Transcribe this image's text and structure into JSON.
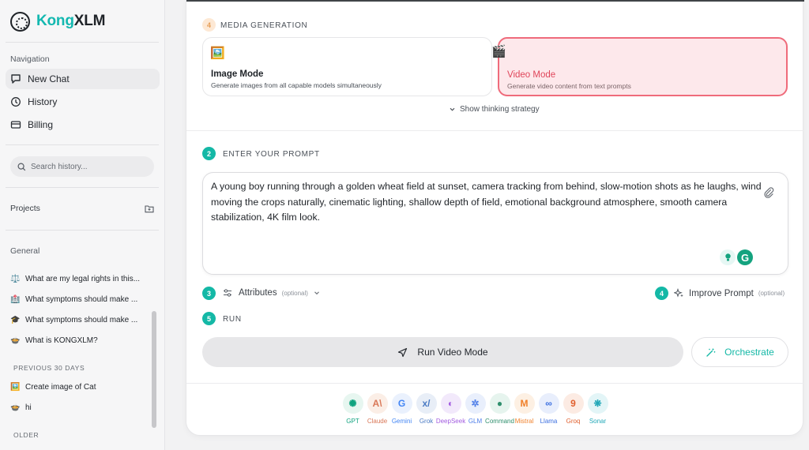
{
  "brand": {
    "name_part1": "Kong",
    "name_part2": "XLM"
  },
  "sidebar": {
    "nav_label": "Navigation",
    "nav_items": [
      {
        "label": "New Chat",
        "icon": "new-chat-icon",
        "active": true
      },
      {
        "label": "History",
        "icon": "history-icon"
      },
      {
        "label": "Billing",
        "icon": "billing-icon"
      }
    ],
    "search_placeholder": "Search history...",
    "projects_label": "Projects",
    "general_label": "General",
    "history": [
      {
        "emoji": "⚖️",
        "text": "What are my legal rights in this..."
      },
      {
        "emoji": "🏥",
        "text": "What symptoms should make ..."
      },
      {
        "emoji": "🎓",
        "text": "What symptoms should make ..."
      },
      {
        "emoji": "🍲",
        "text": "What is KONGXLM?"
      }
    ],
    "previous_30_label": "PREVIOUS 30 DAYS",
    "previous_30": [
      {
        "emoji": "🖼️",
        "text": "Create image of Cat"
      },
      {
        "emoji": "🍲",
        "text": "hi"
      }
    ],
    "older_label": "OLDER"
  },
  "media": {
    "step": "4",
    "label": "MEDIA GENERATION",
    "modes": [
      {
        "title": "Image Mode",
        "desc": "Generate images from all capable models simultaneously",
        "icon": "🖼️",
        "selected": false
      },
      {
        "title": "Video Mode",
        "desc": "Generate video content from text prompts",
        "icon": "🎬",
        "selected": true
      }
    ],
    "thinking_toggle": "Show thinking strategy"
  },
  "prompt": {
    "step": "2",
    "label": "ENTER YOUR PROMPT",
    "text": "A young boy running through a golden wheat field at sunset, camera tracking from behind, slow-motion shots as he laughs, wind moving the crops naturally, cinematic lighting, shallow depth of field, emotional background atmosphere, smooth camera stabilization, 4K film look.",
    "grammarly_letter": "G"
  },
  "options": {
    "attributes_step": "3",
    "attributes_label": "Attributes",
    "attributes_note": "(optional)",
    "improve_step": "4",
    "improve_label": "Improve Prompt",
    "improve_note": "(optional)"
  },
  "run": {
    "step": "5",
    "label": "RUN",
    "run_button": "Run Video Mode",
    "orchestrate_button": "Orchestrate"
  },
  "models": [
    {
      "name": "GPT",
      "glyph": "✺",
      "color": "#10a37f",
      "bg": "#e7f6f0"
    },
    {
      "name": "Claude",
      "glyph": "A\\",
      "color": "#d97757",
      "bg": "#fbeee6"
    },
    {
      "name": "Gemini",
      "glyph": "G",
      "color": "#4285f4",
      "bg": "#eaf1fd"
    },
    {
      "name": "Grok",
      "glyph": "x/",
      "color": "#4b7bc4",
      "bg": "#e8eef7"
    },
    {
      "name": "DeepSeek",
      "glyph": "◐",
      "color": "#a25ce0",
      "bg": "#f2e9fb"
    },
    {
      "name": "GLM",
      "glyph": "✲",
      "color": "#4f7ee8",
      "bg": "#e9effc"
    },
    {
      "name": "Command",
      "glyph": "●",
      "color": "#2f8f6d",
      "bg": "#e6f4ee"
    },
    {
      "name": "Mistral",
      "glyph": "M",
      "color": "#f0802a",
      "bg": "#fdf0e3"
    },
    {
      "name": "Llama",
      "glyph": "∞",
      "color": "#3b6fe0",
      "bg": "#e8eefc"
    },
    {
      "name": "Groq",
      "glyph": "9",
      "color": "#e0602f",
      "bg": "#fcebe3"
    },
    {
      "name": "Sonar",
      "glyph": "❋",
      "color": "#22a8b8",
      "bg": "#e3f5f7"
    }
  ]
}
